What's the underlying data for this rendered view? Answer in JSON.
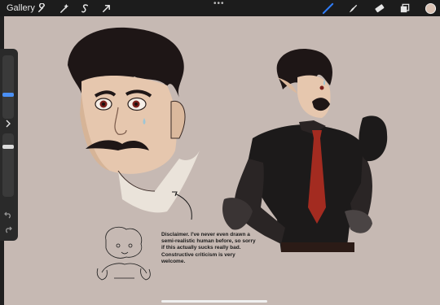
{
  "topbar": {
    "gallery_label": "Gallery",
    "more_dots": "•••",
    "left_tools": [
      "wrench-icon",
      "magic-wand-icon",
      "selection-s-icon",
      "transform-arrow-icon"
    ],
    "right_tools": [
      "brush-icon",
      "smudge-icon",
      "eraser-icon",
      "layers-icon",
      "color-swatch-icon"
    ],
    "accent_color": "#2f7bf5",
    "color_swatch": "#d9c2b3"
  },
  "sidebar": {
    "brush_size_level": 0.32,
    "opacity_level": 0.15,
    "expand_icon": "chevron-right-icon",
    "undo_icon": "undo-icon",
    "redo_icon": "redo-icon"
  },
  "canvas": {
    "background_color": "#c6b9b3",
    "disclaimer": "Disclaimer. I've never even drawn a semi-realistic human before, so sorry if this actually sucks really bad. Constructive criticism is very welcome."
  }
}
